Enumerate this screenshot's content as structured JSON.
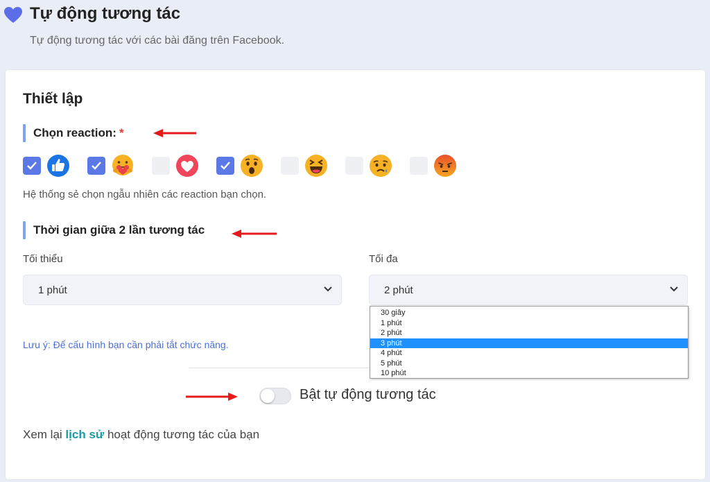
{
  "header": {
    "title": "Tự động tương tác",
    "subtitle": "Tự động tương tác với các bài đăng trên Facebook."
  },
  "settings": {
    "section_title": "Thiết lập",
    "reaction_label": "Chọn reaction:",
    "required_mark": "*",
    "reactions": [
      {
        "icon": "like-icon",
        "checked": true
      },
      {
        "icon": "care-icon",
        "checked": true
      },
      {
        "icon": "love-icon",
        "checked": false
      },
      {
        "icon": "wow-icon",
        "checked": true
      },
      {
        "icon": "haha-icon",
        "checked": false
      },
      {
        "icon": "sad-icon",
        "checked": false
      },
      {
        "icon": "angry-icon",
        "checked": false
      }
    ],
    "reaction_hint": "Hệ thống sẻ chọn ngẫu nhiên các reaction bạn chọn.",
    "interval_label": "Thời gian giữa 2 lần tương tác",
    "min_label": "Tối thiểu",
    "min_value": "1 phút",
    "max_label": "Tối đa",
    "max_value": "2 phút",
    "max_options": [
      "30 giây",
      "1 phút",
      "2 phút",
      "3 phút",
      "4 phút",
      "5 phút",
      "10 phút"
    ],
    "max_highlighted": "3 phút",
    "note": "Lưu ý: Để cấu hình bạn cần phải tắt chức năng.",
    "toggle_label": "Bật tự động tương tác",
    "toggle_on": false,
    "history_prefix": "Xem lại",
    "history_link": "lịch sử",
    "history_suffix": "hoạt động tương tác của bạn"
  },
  "colors": {
    "accent": "#5b79e6",
    "bar": "#7da2f5",
    "link": "#1a9ba5",
    "note": "#4b6fd6",
    "arrow": "#e31b1b",
    "dropdown_highlight": "#1e90ff"
  }
}
